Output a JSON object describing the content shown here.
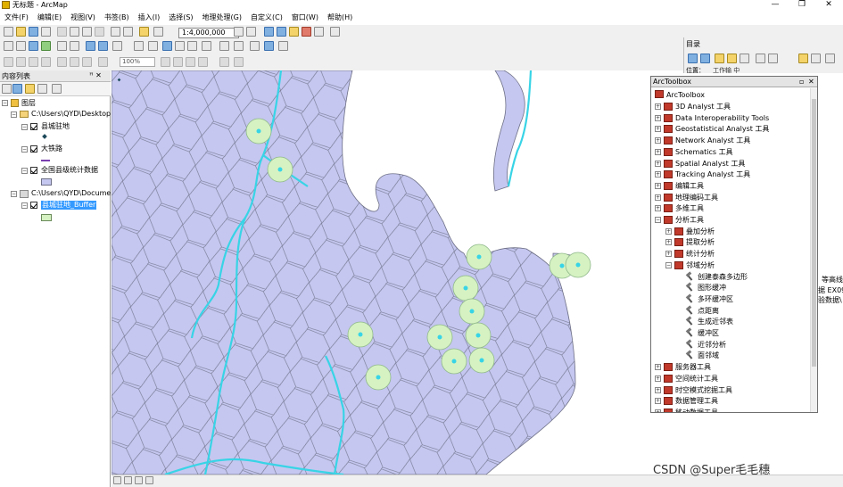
{
  "window": {
    "title": "无标题 - ArcMap",
    "min": "—",
    "max": "❐",
    "close": "✕"
  },
  "menu": [
    "文件(F)",
    "编辑(E)",
    "视图(V)",
    "书签(B)",
    "插入(I)",
    "选择(S)",
    "地理处理(G)",
    "自定义(C)",
    "窗口(W)",
    "帮助(H)"
  ],
  "toolbar": {
    "scale": "1:4,000,000",
    "zoom": "100%"
  },
  "toc": {
    "title": "内容列表",
    "pin": "ꟸ ✕",
    "root": "图层",
    "group1_path": "C:\\Users\\QYD\\Desktop",
    "layer1": "县城驻地",
    "layer2": "大铁路",
    "layer3": "全国县级统计数据",
    "group2_path": "C:\\Users\\QYD\\Docume",
    "layer4": "县城驻地_Buffer"
  },
  "catalog": {
    "title": "目录",
    "location": "位置：",
    "location_value": "工作输 中"
  },
  "toolbox": {
    "title": "ArcToolbox",
    "root": "ArcToolbox",
    "sets": [
      "3D Analyst 工具",
      "Data Interoperability Tools",
      "Geostatistical Analyst 工具",
      "Network Analyst 工具",
      "Schematics 工具",
      "Spatial Analyst 工具",
      "Tracking Analyst 工具",
      "编辑工具",
      "地理编码工具",
      "多维工具",
      "分析工具"
    ],
    "analysis_children": [
      "叠加分析",
      "提取分析",
      "统计分析",
      "邻域分析"
    ],
    "neighborhood_tools": [
      "创建泰森多边形",
      "图形缓冲",
      "多环缓冲区",
      "点距离",
      "生成近邻表",
      "缓冲区",
      "近邻分析",
      "面邻域"
    ],
    "more_sets": [
      "服务器工具",
      "空间统计工具",
      "时空模式挖掘工具",
      "数据管理工具",
      "移动数据工具"
    ]
  },
  "right_fragment": {
    "line1": "等高线",
    "line2": "据 EX09",
    "line3": "验数据\\"
  },
  "watermark": "CSDN @Super毛毛穗",
  "colors": {
    "polygon_fill": "#c5c7f0",
    "polygon_edge": "#6d6f86",
    "river": "#38d4e6",
    "buffer": "#d6f2c2",
    "point": "#1d4a5a"
  }
}
